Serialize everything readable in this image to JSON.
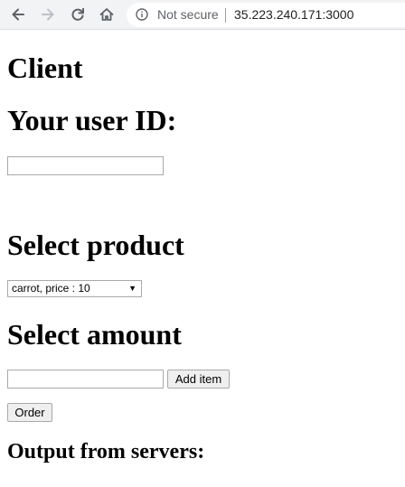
{
  "browser": {
    "security_label": "Not secure",
    "url": "35.223.240.171:3000",
    "icons": [
      "back-icon",
      "forward-icon",
      "reload-icon",
      "home-icon",
      "info-icon"
    ]
  },
  "page": {
    "title": "Client",
    "user_id_heading": "Your user ID:",
    "user_id_value": "",
    "product_heading": "Select product",
    "product_selected": "carrot, price : 10",
    "amount_heading": "Select amount",
    "amount_value": "",
    "add_item_label": "Add item",
    "order_label": "Order",
    "output_heading": "Output from servers:"
  }
}
